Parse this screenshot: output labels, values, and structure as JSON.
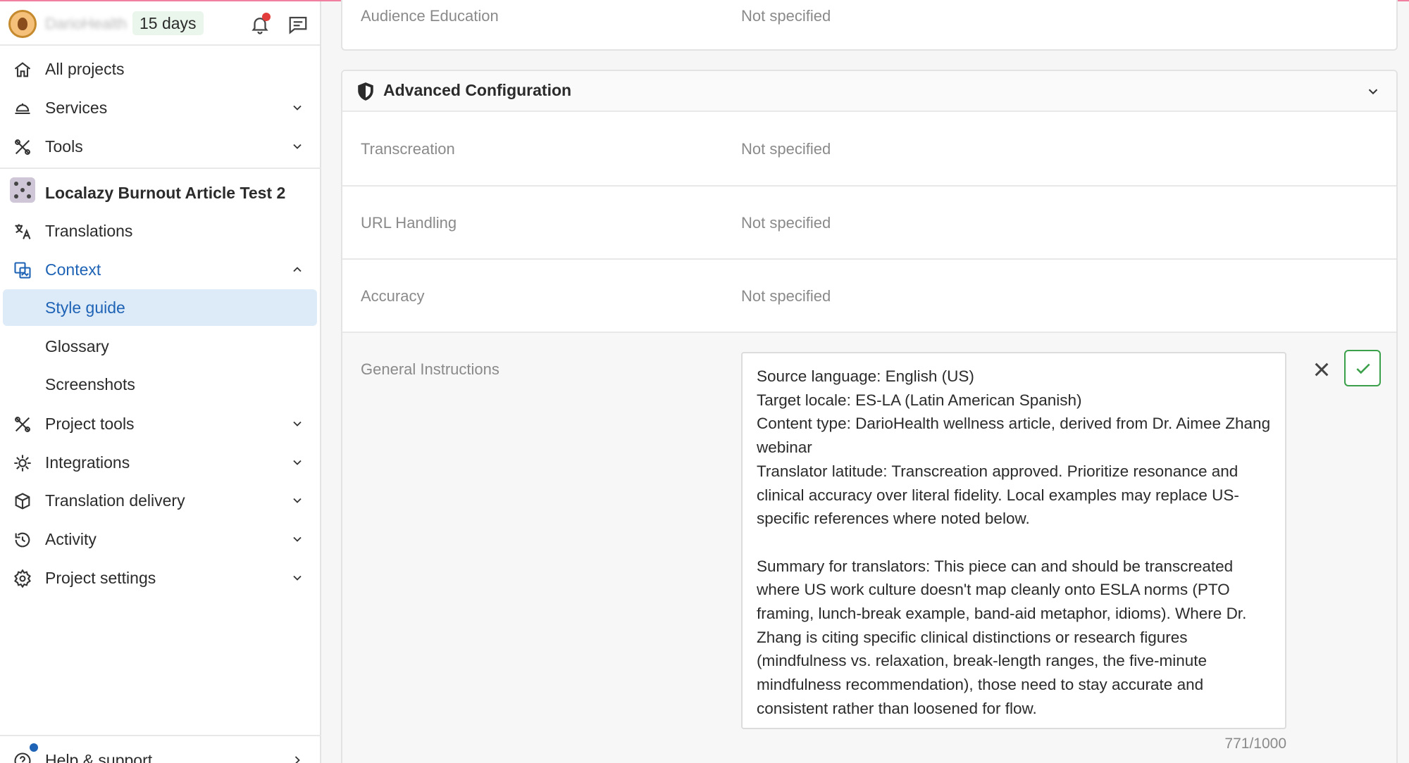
{
  "header": {
    "org_name": "DarioHealth",
    "trial_badge": "15 days"
  },
  "sidebar": {
    "all_projects": "All projects",
    "services": "Services",
    "tools": "Tools",
    "project_name": "Localazy Burnout Article Test 2",
    "translations": "Translations",
    "context": "Context",
    "style_guide": "Style guide",
    "glossary": "Glossary",
    "screenshots": "Screenshots",
    "project_tools": "Project tools",
    "integrations": "Integrations",
    "translation_delivery": "Translation delivery",
    "activity": "Activity",
    "project_settings": "Project settings",
    "help_support": "Help & support"
  },
  "audience_card": {
    "label": "Audience Education",
    "value": "Not specified"
  },
  "advanced": {
    "title": "Advanced Configuration",
    "rows": [
      {
        "label": "Transcreation",
        "value": "Not specified"
      },
      {
        "label": "URL Handling",
        "value": "Not specified"
      },
      {
        "label": "Accuracy",
        "value": "Not specified"
      }
    ],
    "general_label": "General Instructions",
    "general_text": "Source language: English (US)\nTarget locale: ES-LA (Latin American Spanish)\nContent type: DarioHealth wellness article, derived from Dr. Aimee Zhang webinar\nTranslator latitude: Transcreation approved. Prioritize resonance and clinical accuracy over literal fidelity. Local examples may replace US-specific references where noted below.\n\nSummary for translators: This piece can and should be transcreated where US work culture doesn't map cleanly onto ESLA norms (PTO framing, lunch-break example, band-aid metaphor, idioms). Where Dr. Zhang is citing specific clinical distinctions or research figures (mindfulness vs. relaxation, break-length ranges, the five-minute mindfulness recommendation), those need to stay accurate and consistent rather than loosened for flow.",
    "char_count": "771/1000"
  }
}
